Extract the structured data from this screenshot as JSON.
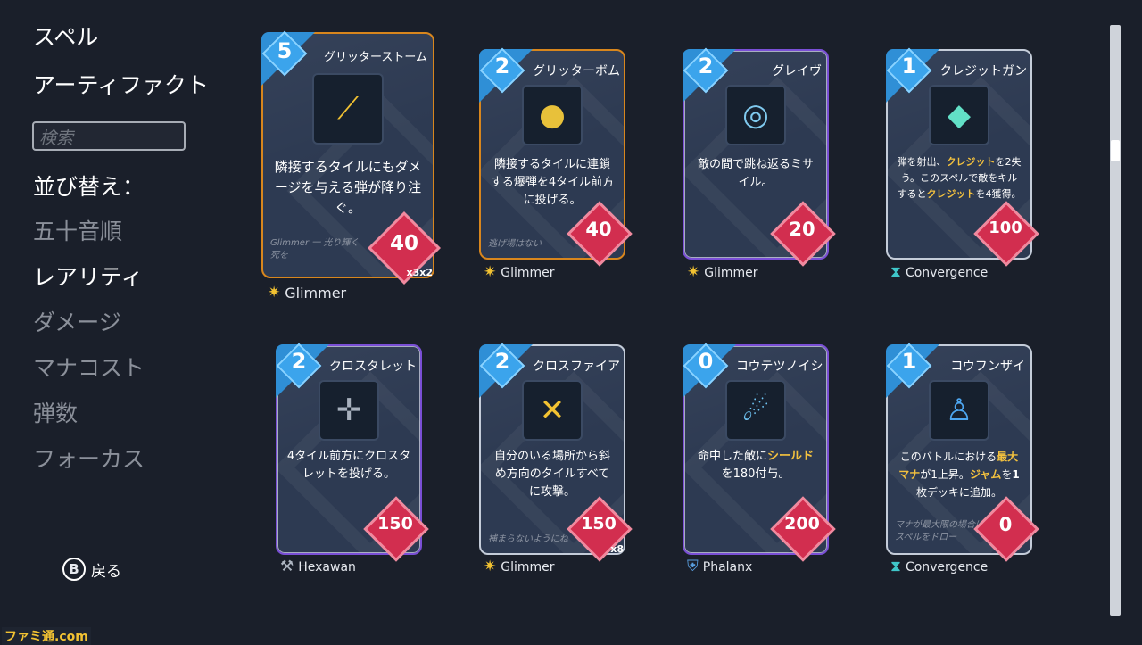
{
  "sidebar": {
    "spells_label": "スペル",
    "artifacts_label": "アーティファクト",
    "search_placeholder": "検索",
    "sort_label": "並び替え：",
    "sort_options": [
      "五十音順",
      "レアリティ",
      "ダメージ",
      "マナコスト",
      "弾数",
      "フォーカス"
    ]
  },
  "back": {
    "button": "B",
    "label": "戻る"
  },
  "cards": [
    {
      "mana": "5",
      "title": "グリッターストーム",
      "desc": "隣接するタイルにもダメージを与える弾が降り注ぐ。",
      "flavor": "Glimmer 一 光り輝く死を",
      "damage": "40",
      "multiplier": "x3x2",
      "school": "Glimmer",
      "school_icon": "sparkle-icon",
      "art": "shards-icon"
    },
    {
      "mana": "2",
      "title": "グリッターボム",
      "desc": "隣接するタイルに連鎖する爆弾を4タイル前方に投げる。",
      "flavor": "逃げ場はない",
      "damage": "40",
      "multiplier": "",
      "school": "Glimmer",
      "school_icon": "sparkle-icon",
      "art": "bomb-icon"
    },
    {
      "mana": "2",
      "title": "グレイヴ",
      "desc": "敵の間で跳ね返るミサイル。",
      "flavor": "",
      "damage": "20",
      "multiplier": "",
      "school": "Glimmer",
      "school_icon": "sparkle-icon",
      "art": "swirl-icon"
    },
    {
      "mana": "1",
      "title": "クレジットガン",
      "desc_parts": [
        "弾を射出、",
        "クレジット",
        "を2失う。このスペルで敵をキルすると",
        "クレジット",
        "を4獲得。"
      ],
      "flavor": "",
      "damage": "100",
      "multiplier": "",
      "school": "Convergence",
      "school_icon": "hourglass-icon",
      "art": "gem-icon"
    },
    {
      "mana": "2",
      "title": "クロスタレット",
      "desc": "4タイル前方にクロスタレットを投げる。",
      "flavor": "",
      "damage": "150",
      "multiplier": "",
      "school": "Hexawan",
      "school_icon": "wrench-icon",
      "art": "turret-icon"
    },
    {
      "mana": "2",
      "title": "クロスファイア",
      "desc": "自分のいる場所から斜め方向のタイルすべてに攻撃。",
      "flavor": "捕まらないようにね",
      "damage": "150",
      "multiplier": "x8",
      "school": "Glimmer",
      "school_icon": "sparkle-icon",
      "art": "cross-icon"
    },
    {
      "mana": "0",
      "title": "コウテツノイシ",
      "desc_parts": [
        "命中した敵に",
        "シールド",
        "を180付与。"
      ],
      "flavor": "",
      "damage": "200",
      "multiplier": "",
      "school": "Phalanx",
      "school_icon": "shield-icon",
      "art": "comet-icon"
    },
    {
      "mana": "1",
      "title": "コウフンザイ",
      "desc_parts": [
        "このバトルにおける",
        "最大マナ",
        "が1上昇。",
        "ジャム",
        "を",
        "1",
        "枚デッキに追加。"
      ],
      "flavor": "マナが最大限の場合はスペルをドロー",
      "damage": "0",
      "multiplier": "",
      "school": "Convergence",
      "school_icon": "hourglass-icon",
      "art": "figure-icon"
    }
  ],
  "watermark": "ファミ通.com",
  "colors": {
    "mana": "#3ba4ec",
    "damage": "#d22e4f",
    "highlight": "#f3c13e",
    "background": "#1a1f2a"
  }
}
